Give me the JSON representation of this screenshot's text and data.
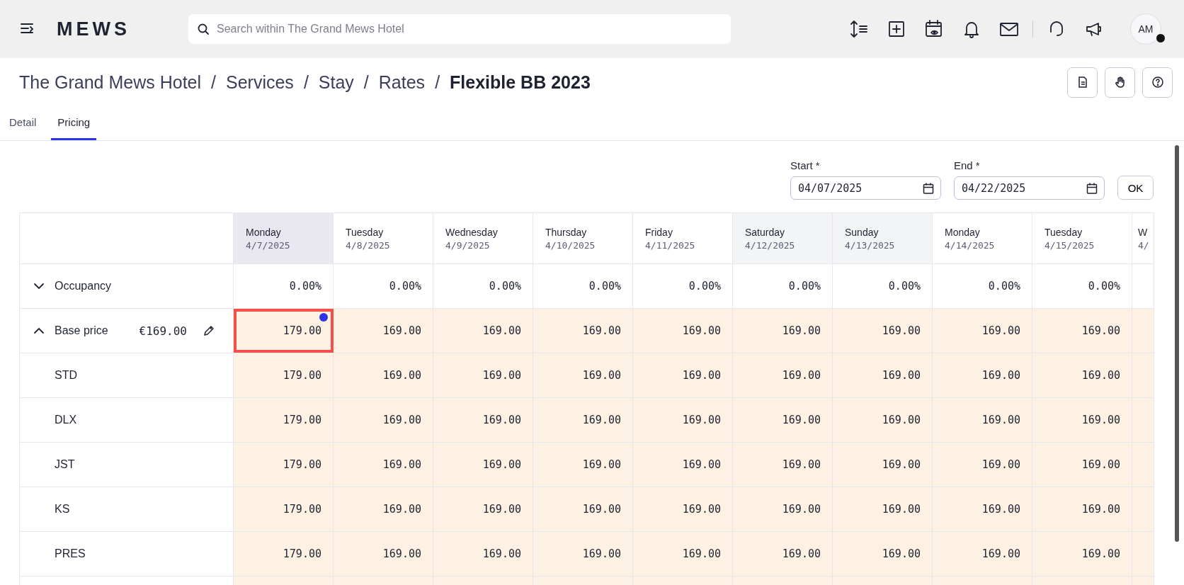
{
  "top_bar": {
    "logo": "MEWS",
    "search": {
      "placeholder": "Search within The Grand Mews Hotel"
    },
    "avatar": {
      "initials": "AM"
    }
  },
  "breadcrumb": [
    {
      "kind": "link",
      "label": "The Grand Mews Hotel"
    },
    {
      "kind": "separator",
      "label": "/"
    },
    {
      "kind": "link",
      "label": "Services"
    },
    {
      "kind": "separator",
      "label": "/"
    },
    {
      "kind": "link",
      "label": "Stay"
    },
    {
      "kind": "separator",
      "label": "/"
    },
    {
      "kind": "link",
      "label": "Rates"
    },
    {
      "kind": "separator",
      "label": "/"
    },
    {
      "kind": "current",
      "label": "Flexible BB 2023"
    }
  ],
  "tabs": [
    {
      "label": "Detail",
      "selected": false
    },
    {
      "label": "Pricing",
      "selected": true
    }
  ],
  "date_range": {
    "start": {
      "label": "Start *",
      "value": "04/07/2025"
    },
    "end": {
      "label": "End *",
      "value": "04/22/2025"
    },
    "ok": "OK"
  },
  "table": {
    "columns": [
      {
        "day": "Monday",
        "date": "4/7/2025",
        "weekend": false,
        "selected": true
      },
      {
        "day": "Tuesday",
        "date": "4/8/2025",
        "weekend": false,
        "selected": false
      },
      {
        "day": "Wednesday",
        "date": "4/9/2025",
        "weekend": false,
        "selected": false
      },
      {
        "day": "Thursday",
        "date": "4/10/2025",
        "weekend": false,
        "selected": false
      },
      {
        "day": "Friday",
        "date": "4/11/2025",
        "weekend": false,
        "selected": false
      },
      {
        "day": "Saturday",
        "date": "4/12/2025",
        "weekend": true,
        "selected": false
      },
      {
        "day": "Sunday",
        "date": "4/13/2025",
        "weekend": true,
        "selected": false
      },
      {
        "day": "Monday",
        "date": "4/14/2025",
        "weekend": false,
        "selected": false
      },
      {
        "day": "Tuesday",
        "date": "4/15/2025",
        "weekend": false,
        "selected": false
      },
      {
        "day": "W",
        "date": "4/",
        "weekend": false,
        "selected": false
      }
    ],
    "rows": [
      {
        "kind": "occupancy",
        "label": "Occupancy",
        "expanded": false,
        "cells": [
          "0.00%",
          "0.00%",
          "0.00%",
          "0.00%",
          "0.00%",
          "0.00%",
          "0.00%",
          "0.00%",
          "0.00%"
        ]
      },
      {
        "kind": "base",
        "label": "Base price",
        "amount": "€169.00",
        "expanded": true,
        "cells": [
          {
            "value": "179.00",
            "selected": true,
            "edited": true
          },
          {
            "value": "169.00",
            "selected": false,
            "edited": false
          },
          {
            "value": "169.00",
            "selected": false,
            "edited": false
          },
          {
            "value": "169.00",
            "selected": false,
            "edited": false
          },
          {
            "value": "169.00",
            "selected": false,
            "edited": false
          },
          {
            "value": "169.00",
            "selected": false,
            "edited": false
          },
          {
            "value": "169.00",
            "selected": false,
            "edited": false
          },
          {
            "value": "169.00",
            "selected": false,
            "edited": false
          },
          {
            "value": "169.00",
            "selected": false,
            "edited": false
          }
        ],
        "children": [
          {
            "label": "STD",
            "cells": [
              "179.00",
              "169.00",
              "169.00",
              "169.00",
              "169.00",
              "169.00",
              "169.00",
              "169.00",
              "169.00"
            ]
          },
          {
            "label": "DLX",
            "cells": [
              "179.00",
              "169.00",
              "169.00",
              "169.00",
              "169.00",
              "169.00",
              "169.00",
              "169.00",
              "169.00"
            ]
          },
          {
            "label": "JST",
            "cells": [
              "179.00",
              "169.00",
              "169.00",
              "169.00",
              "169.00",
              "169.00",
              "169.00",
              "169.00",
              "169.00"
            ]
          },
          {
            "label": "KS",
            "cells": [
              "179.00",
              "169.00",
              "169.00",
              "169.00",
              "169.00",
              "169.00",
              "169.00",
              "169.00",
              "169.00"
            ]
          },
          {
            "label": "PRES",
            "cells": [
              "179.00",
              "169.00",
              "169.00",
              "169.00",
              "169.00",
              "169.00",
              "169.00",
              "169.00",
              "169.00"
            ]
          }
        ]
      }
    ]
  }
}
